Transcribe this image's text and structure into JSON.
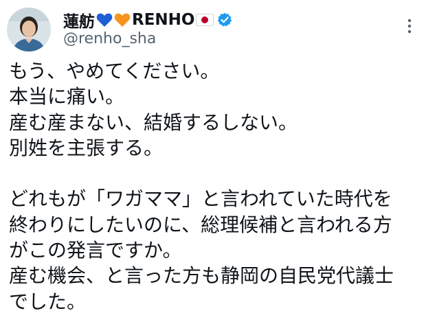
{
  "author": {
    "display_name": "蓮舫",
    "display_name_suffix": "RENHO",
    "handle": "@renho_sha",
    "verified": true,
    "emoji_icons": [
      "blue-heart-icon",
      "orange-heart-icon",
      "japan-flag-icon",
      "verified-badge-icon"
    ]
  },
  "menu": {
    "icon": "more-vertical-icon"
  },
  "tweet": {
    "lines": [
      "もう、やめてください。",
      "本当に痛い。",
      "産む産まない、結婚するしない。",
      "別姓を主張する。",
      "",
      "どれもが「ワガママ」と言われていた時代を",
      "終わりにしたいのに、総理候補と言われる方",
      "がこの発言ですか。",
      "産む機会、と言った方も静岡の自民党代議士",
      "でした。"
    ]
  },
  "colors": {
    "text": "#0f1419",
    "secondary": "#536471",
    "verified": "#1d9bf0",
    "blue_heart": "#1d5fd6",
    "orange_heart": "#f7941d",
    "flag_red": "#bc002d"
  }
}
